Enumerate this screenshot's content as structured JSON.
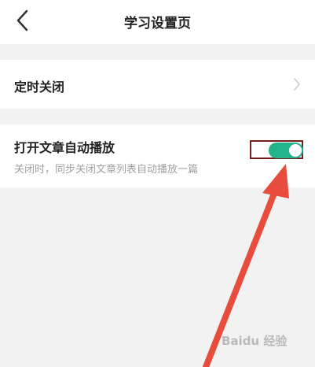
{
  "nav": {
    "title": "学习设置页"
  },
  "settings": {
    "timer_label": "定时关闭",
    "autoplay_label": "打开文章自动播放",
    "autoplay_desc": "关闭时，同步关闭文章列表自动播放一篇",
    "autoplay_enabled": true
  },
  "watermark": {
    "text": "Baidu 经验"
  },
  "colors": {
    "accent": "#22b38a",
    "highlight_box": "#7a1f1f",
    "arrow": "#e74c3c"
  }
}
